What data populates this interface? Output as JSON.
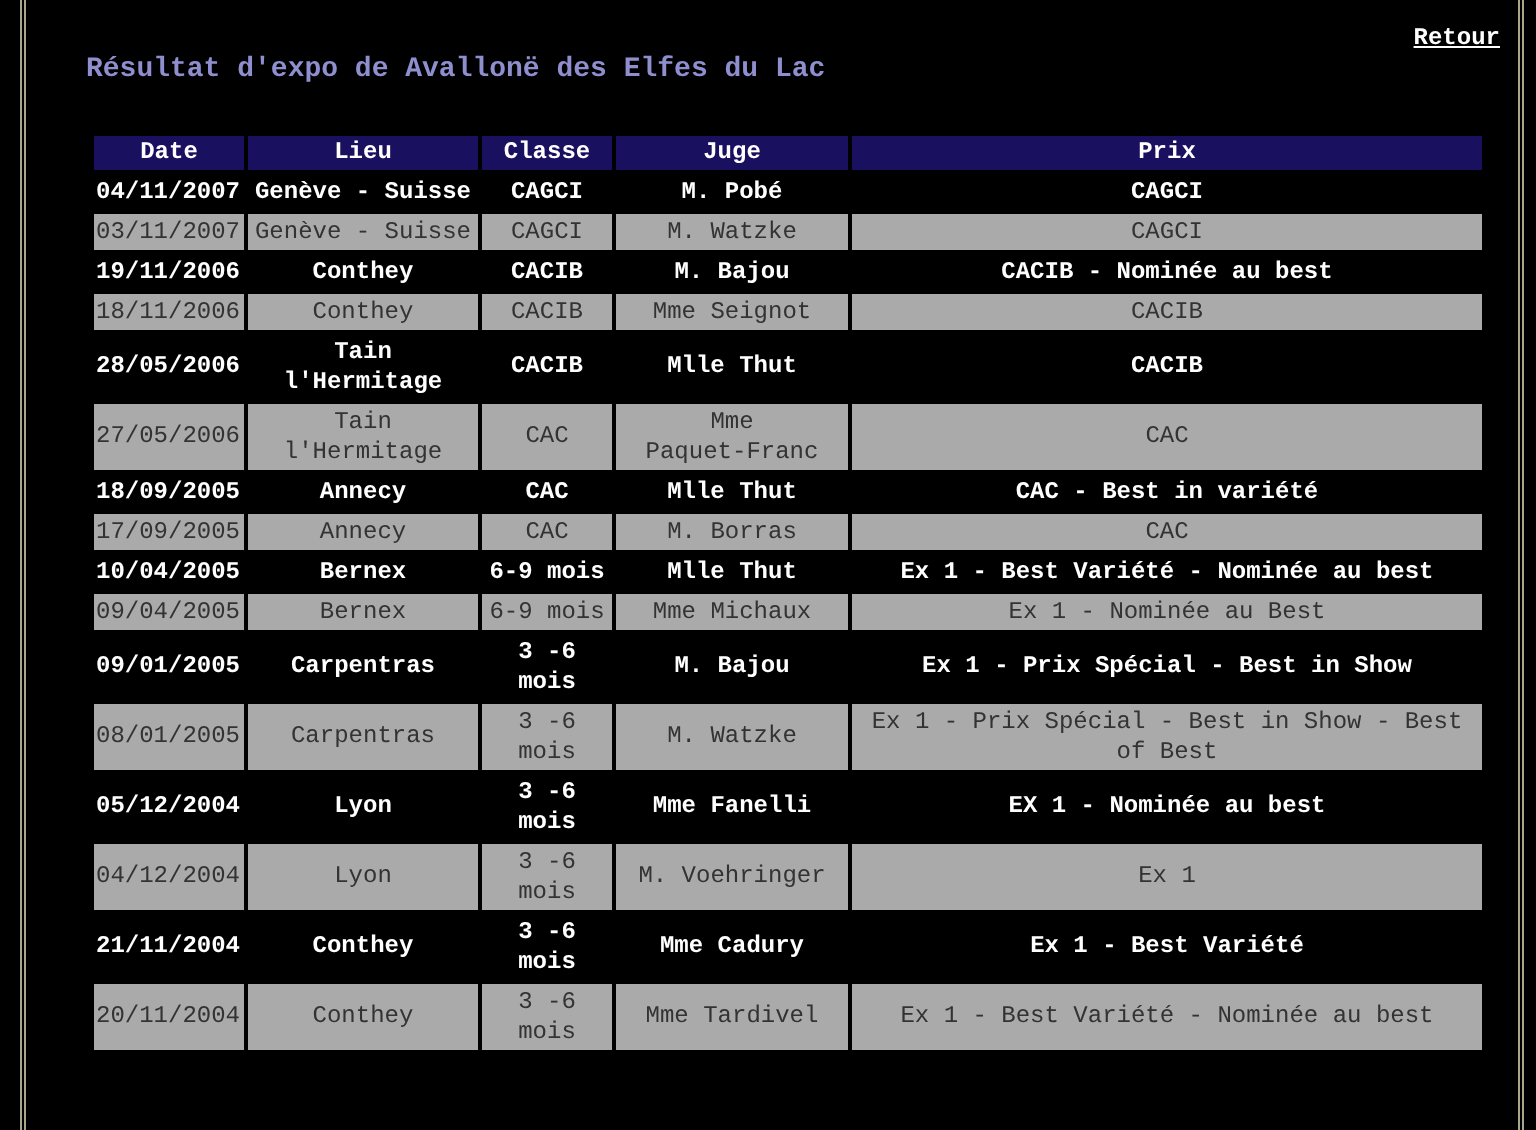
{
  "back_link": "Retour",
  "title": "Résultat d'expo de Avallonë des Elfes du Lac",
  "table": {
    "columns": [
      "Date",
      "Lieu",
      "Classe",
      "Juge",
      "Prix"
    ],
    "rows": [
      {
        "kind": "dark",
        "cells": [
          "04/11/2007",
          "Genève - Suisse",
          "CAGCI",
          "M. Pobé",
          "CAGCI"
        ]
      },
      {
        "kind": "grey",
        "cells": [
          "03/11/2007",
          "Genève - Suisse",
          "CAGCI",
          "M. Watzke",
          "CAGCI"
        ]
      },
      {
        "kind": "dark",
        "cells": [
          "19/11/2006",
          "Conthey",
          "CACIB",
          "M. Bajou",
          "CACIB - Nominée au best"
        ]
      },
      {
        "kind": "grey",
        "cells": [
          "18/11/2006",
          "Conthey",
          "CACIB",
          "Mme Seignot",
          "CACIB"
        ]
      },
      {
        "kind": "dark",
        "cells": [
          "28/05/2006",
          "Tain l'Hermitage",
          "CACIB",
          "Mlle Thut",
          "CACIB"
        ]
      },
      {
        "kind": "grey",
        "cells": [
          "27/05/2006",
          "Tain l'Hermitage",
          "CAC",
          "Mme Paquet-Franc",
          "CAC"
        ]
      },
      {
        "kind": "dark",
        "cells": [
          "18/09/2005",
          "Annecy",
          "CAC",
          "Mlle Thut",
          "CAC - Best in variété"
        ]
      },
      {
        "kind": "grey",
        "cells": [
          "17/09/2005",
          "Annecy",
          "CAC",
          "M. Borras",
          "CAC"
        ]
      },
      {
        "kind": "dark",
        "cells": [
          "10/04/2005",
          "Bernex",
          "6-9 mois",
          "Mlle Thut",
          "Ex 1 - Best Variété - Nominée au best"
        ]
      },
      {
        "kind": "grey",
        "cells": [
          "09/04/2005",
          "Bernex",
          "6-9 mois",
          "Mme Michaux",
          "Ex 1 - Nominée au Best"
        ]
      },
      {
        "kind": "dark",
        "cells": [
          "09/01/2005",
          "Carpentras",
          "3 -6 mois",
          "M. Bajou",
          "Ex 1 - Prix Spécial - Best in Show"
        ]
      },
      {
        "kind": "grey",
        "cells": [
          "08/01/2005",
          "Carpentras",
          "3 -6 mois",
          "M. Watzke",
          "Ex 1 - Prix Spécial - Best in Show - Best of Best"
        ]
      },
      {
        "kind": "dark",
        "cells": [
          "05/12/2004",
          "Lyon",
          "3 -6 mois",
          "Mme Fanelli",
          "EX 1 - Nominée au best"
        ]
      },
      {
        "kind": "grey",
        "cells": [
          "04/12/2004",
          "Lyon",
          "3 -6 mois",
          "M. Voehringer",
          "Ex 1"
        ]
      },
      {
        "kind": "dark",
        "cells": [
          "21/11/2004",
          "Conthey",
          "3 -6 mois",
          "Mme Cadury",
          "Ex 1 - Best Variété"
        ]
      },
      {
        "kind": "grey",
        "cells": [
          "20/11/2004",
          "Conthey",
          "3 -6 mois",
          "Mme Tardivel",
          "Ex 1 - Best Variété - Nominée au best"
        ]
      }
    ]
  }
}
